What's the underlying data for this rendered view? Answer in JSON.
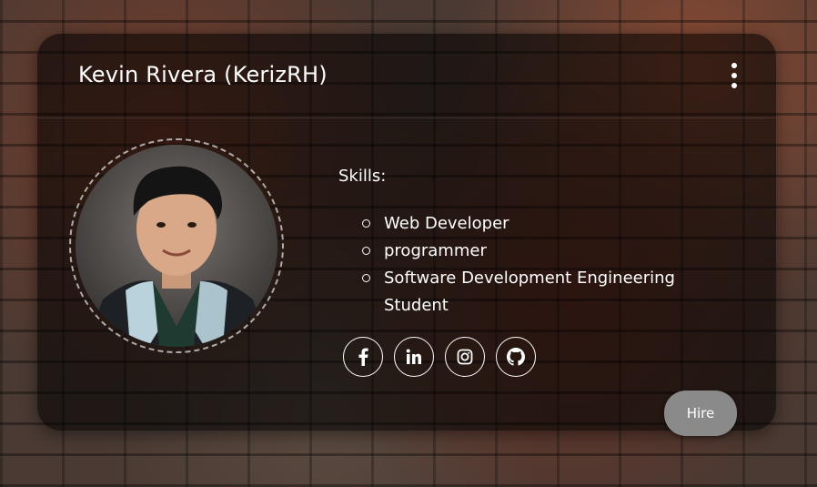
{
  "card": {
    "title": "Kevin Rivera (KerizRH)"
  },
  "skills": {
    "heading": "Skills:",
    "items": [
      "Web Developer",
      "programmer",
      "Software Development Engineering Student"
    ]
  },
  "social": [
    {
      "icon": "facebook-icon"
    },
    {
      "icon": "linkedin-icon"
    },
    {
      "icon": "instagram-icon"
    },
    {
      "icon": "github-icon"
    }
  ],
  "hire_label": "Hire",
  "colors": {
    "card_bg": "#000000",
    "text": "#ffffff",
    "hire_bg": "#8a8a8a"
  }
}
